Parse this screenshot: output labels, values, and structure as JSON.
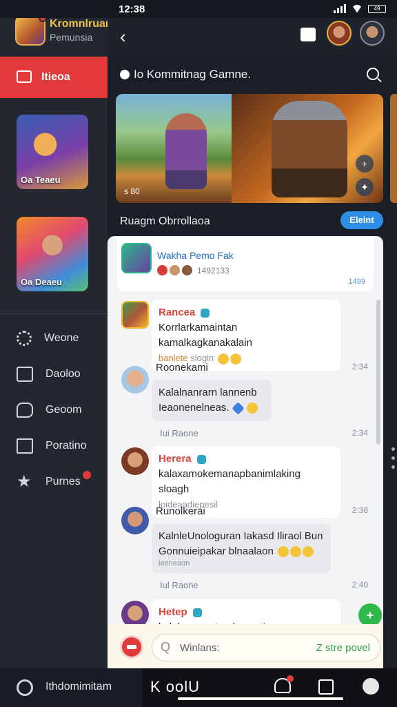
{
  "status": {
    "time": "12:38",
    "battery": "49"
  },
  "sidebar": {
    "profile_name": "Kromnlruan",
    "profile_sub": "Pemunsia",
    "active_item": "Itieoa",
    "cards": [
      {
        "label": "Oa Teaeu"
      },
      {
        "label": "Oa Deaeu"
      }
    ],
    "menu": [
      {
        "label": "Weone",
        "icon": "gear-icon"
      },
      {
        "label": "Daoloo",
        "icon": "inbox-icon"
      },
      {
        "label": "Geoom",
        "icon": "chat-icon"
      },
      {
        "label": "Poratino",
        "icon": "tv-icon"
      },
      {
        "label": "Purnes",
        "icon": "star-icon"
      }
    ]
  },
  "header": {
    "back": "‹"
  },
  "main": {
    "game_title": "Io Kommitnag Gamne.",
    "banner_tag": "s 80",
    "section_title": "Ruagm Obrrollaoa",
    "section_button": "Eleint"
  },
  "pinned": {
    "name": "Wakha Pemo Fak",
    "reactions_count": "1492133",
    "time": "1499"
  },
  "messages": [
    {
      "sender": "Rancea",
      "line1": "Korrlarkamaintan kamalkagkanakalain",
      "line2_orange": "banlete",
      "line2": "slogin",
      "time": ""
    },
    {
      "sender": "Roonekami",
      "time": "2:34",
      "line1": "Kalalnanrarn lannenb",
      "line2": "Ieaonenelneas."
    },
    {
      "reply_label": "Iui Raone",
      "reply_time": "2:34"
    },
    {
      "sender": "Herera",
      "line1": "kalaxamokemanapbanimlaking sloagh",
      "line2": "loideaadiepesil",
      "time": ""
    },
    {
      "sender": "Runolkerai",
      "time": "2:38",
      "line1": "KalnleUnologuran Iakasd Iliraol Bun",
      "line2": "Gonnuieipakar blnaalaon",
      "line3": "ieeneaon"
    },
    {
      "reply_label": "Iul Raone",
      "reply_time": "2:40"
    },
    {
      "sender": "Hetep",
      "line1": "kolaheanen tandencoaianen",
      "time": ""
    }
  ],
  "input": {
    "placeholder": "Winlans:",
    "action": "Z stre povel"
  },
  "bottom": {
    "left_label": "Ithdomimitam",
    "right_label": "K oolU"
  },
  "colors": {
    "accent_red": "#e23a3a",
    "accent_blue": "#2f8ee8",
    "accent_green": "#2fb84c",
    "sender_red": "#d6453a"
  }
}
